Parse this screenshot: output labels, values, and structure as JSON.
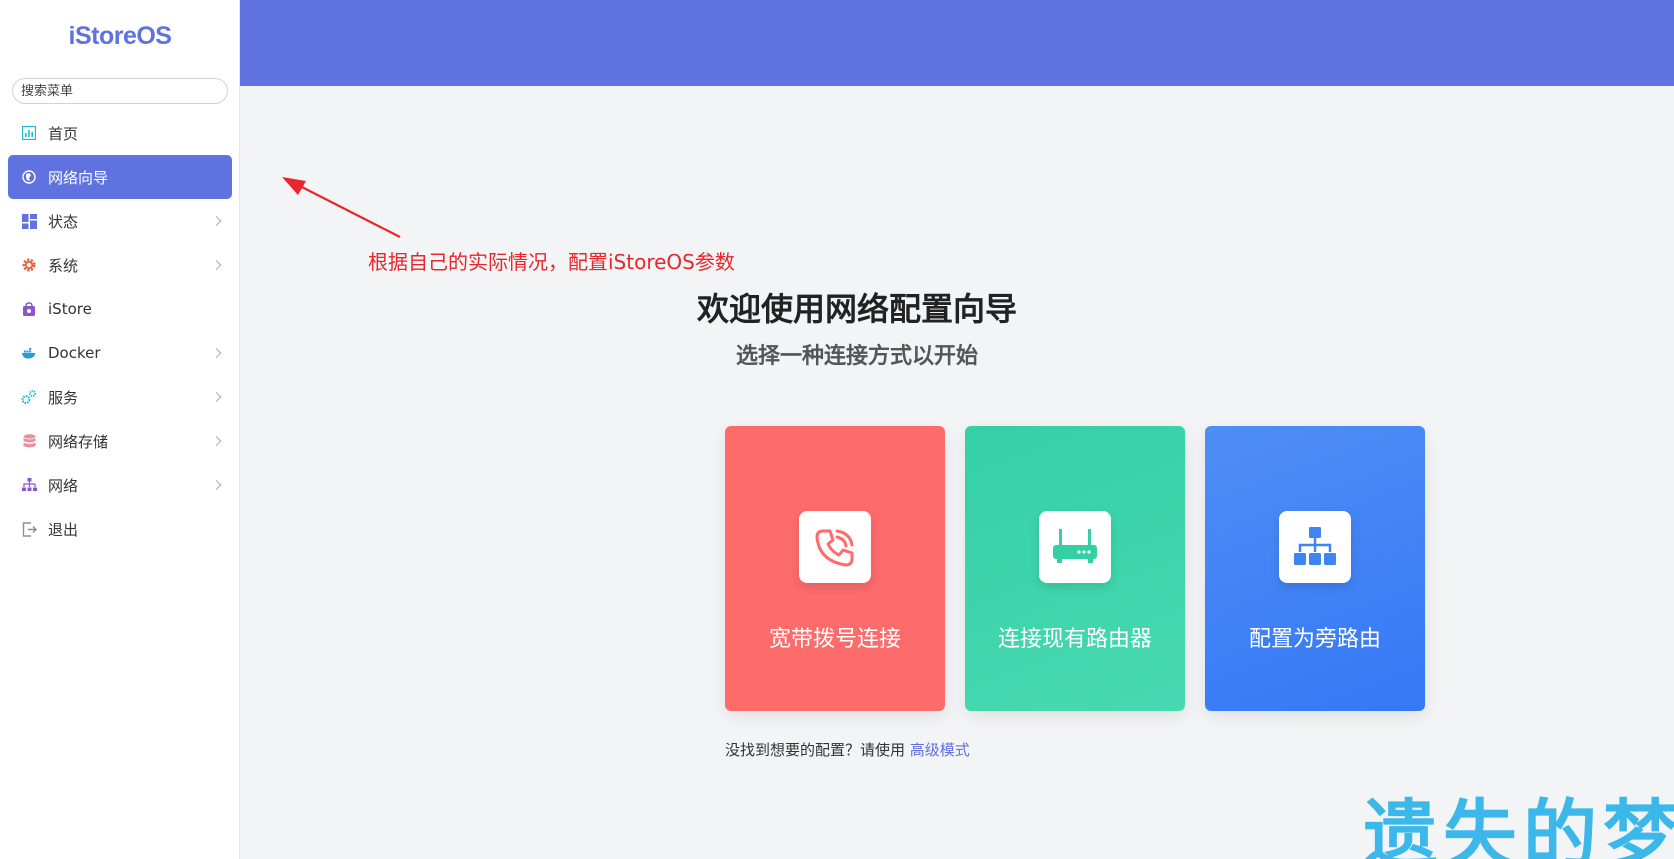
{
  "app": {
    "logo": "iStoreOS"
  },
  "search": {
    "placeholder": "搜索菜单"
  },
  "sidebar": {
    "items": [
      {
        "label": "首页",
        "icon": "dashboard-icon",
        "active": false,
        "submenu": false
      },
      {
        "label": "网络向导",
        "icon": "globe-icon",
        "active": true,
        "submenu": false
      },
      {
        "label": "状态",
        "icon": "grid-icon",
        "active": false,
        "submenu": true
      },
      {
        "label": "系统",
        "icon": "gear-icon",
        "active": false,
        "submenu": true
      },
      {
        "label": "iStore",
        "icon": "bag-icon",
        "active": false,
        "submenu": false
      },
      {
        "label": "Docker",
        "icon": "docker-icon",
        "active": false,
        "submenu": true
      },
      {
        "label": "服务",
        "icon": "gears-icon",
        "active": false,
        "submenu": true
      },
      {
        "label": "网络存储",
        "icon": "database-icon",
        "active": false,
        "submenu": true
      },
      {
        "label": "网络",
        "icon": "network-icon",
        "active": false,
        "submenu": true
      },
      {
        "label": "退出",
        "icon": "logout-icon",
        "active": false,
        "submenu": false
      }
    ]
  },
  "annotation": {
    "text": "根据自己的实际情况，配置iStoreOS参数"
  },
  "main": {
    "title": "欢迎使用网络配置向导",
    "subtitle": "选择一种连接方式以开始",
    "cards": [
      {
        "label": "宽带拨号连接",
        "icon": "phone-icon"
      },
      {
        "label": "连接现有路由器",
        "icon": "router-icon"
      },
      {
        "label": "配置为旁路由",
        "icon": "hierarchy-icon"
      }
    ],
    "footer_prefix": "没找到想要的配置？请使用 ",
    "footer_link": "高级模式"
  },
  "watermark": {
    "text": "遗失的梦"
  },
  "colors": {
    "accent": "#5f72df",
    "card_red": "#fe6b6b",
    "card_green": "#3dd6aa",
    "card_blue": "#3f84f5",
    "annotation": "#e8262b"
  }
}
